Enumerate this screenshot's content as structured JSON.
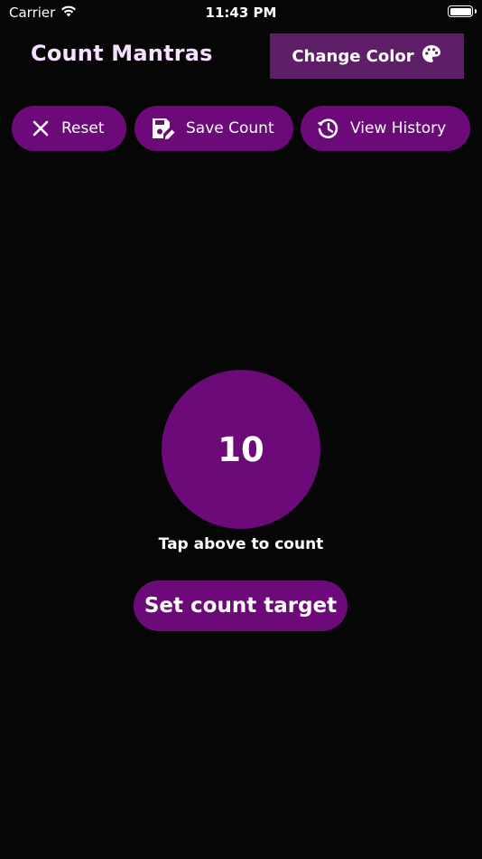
{
  "status_bar": {
    "carrier": "Carrier",
    "time": "11:43 PM",
    "wifi_icon": "wifi-icon",
    "battery_icon": "battery-icon"
  },
  "header": {
    "title": "Count Mantras",
    "change_color_label": "Change Color",
    "change_color_icon": "palette-icon"
  },
  "actions": {
    "reset_label": "Reset",
    "reset_icon": "close-icon",
    "save_label": "Save Count",
    "save_icon": "save-edit-icon",
    "history_label": "View History",
    "history_icon": "history-icon"
  },
  "counter": {
    "value": "10",
    "hint": "Tap above to count"
  },
  "target": {
    "label": "Set count target"
  },
  "colors": {
    "background": "#060606",
    "accent": "#6d0a7a",
    "change_color_bg": "#5f1e68",
    "title_color": "#f7e1ff"
  }
}
